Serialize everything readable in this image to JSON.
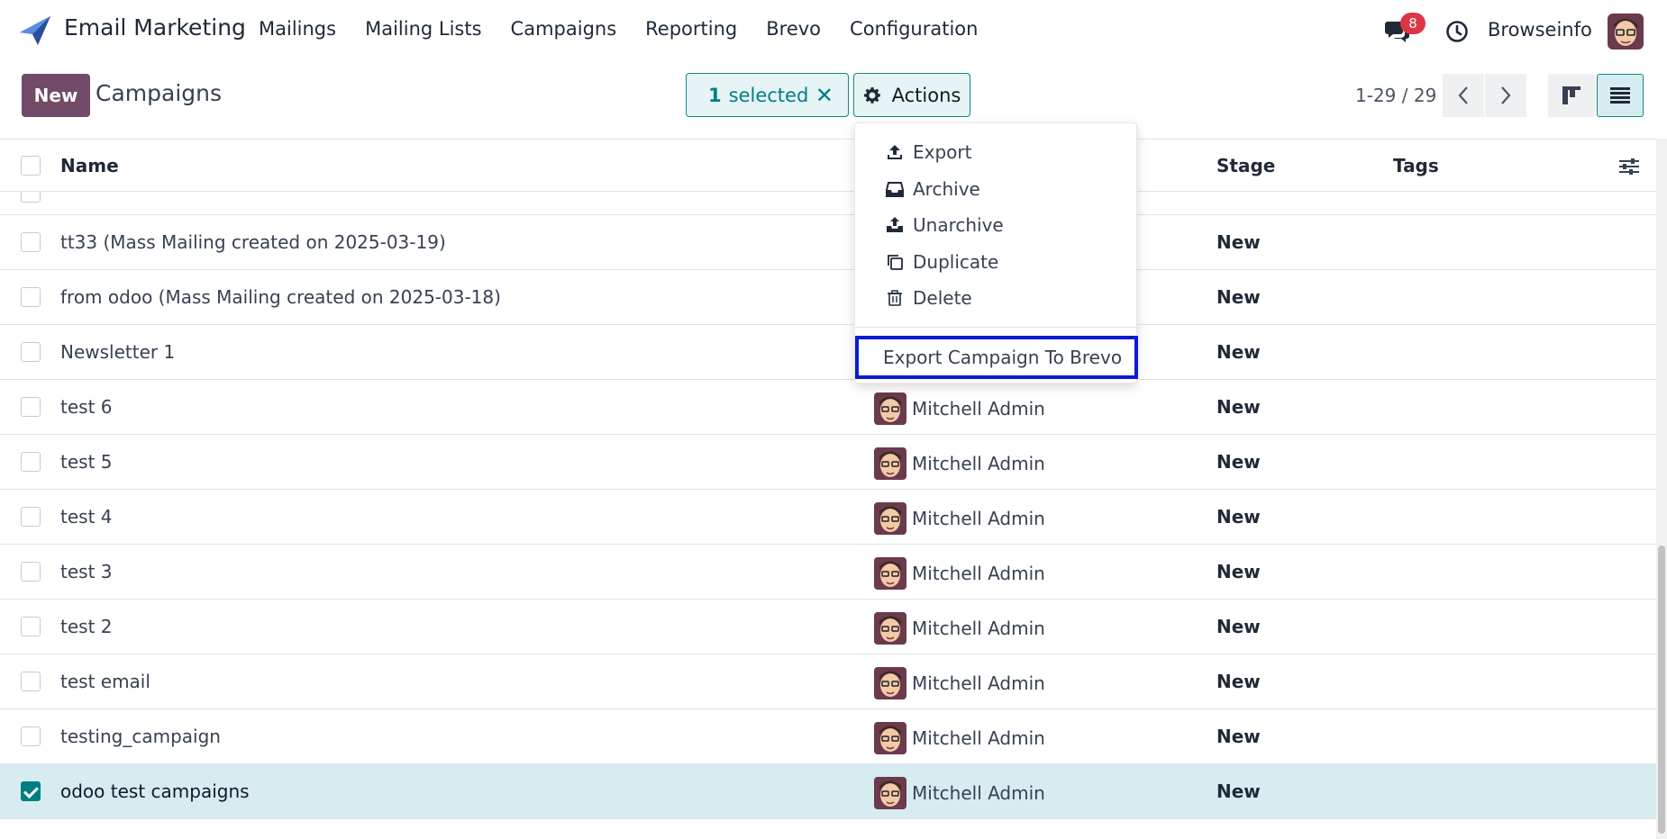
{
  "navbar": {
    "app_name": "Email Marketing",
    "menu": [
      "Mailings",
      "Mailing Lists",
      "Campaigns",
      "Reporting",
      "Brevo",
      "Configuration"
    ],
    "messages_badge": "8",
    "company": "Browseinfo"
  },
  "control_panel": {
    "new_label": "New",
    "title": "Campaigns",
    "selected_count": "1",
    "selected_label": "selected",
    "clear_icon": "✕",
    "actions_label": "Actions",
    "pager_text": "1-29 / 29"
  },
  "table": {
    "headers": {
      "name": "Name",
      "stage": "Stage",
      "tags": "Tags"
    },
    "rows": [
      {
        "name": "tt33 (Mass Mailing created on 2025-03-19)",
        "responsible": "",
        "stage": "New",
        "selected": false
      },
      {
        "name": "from odoo (Mass Mailing created on 2025-03-18)",
        "responsible": "",
        "stage": "New",
        "selected": false
      },
      {
        "name": "Newsletter 1",
        "responsible": "",
        "stage": "New",
        "selected": false
      },
      {
        "name": "test 6",
        "responsible": "Mitchell Admin",
        "stage": "New",
        "selected": false
      },
      {
        "name": "test 5",
        "responsible": "Mitchell Admin",
        "stage": "New",
        "selected": false
      },
      {
        "name": "test 4",
        "responsible": "Mitchell Admin",
        "stage": "New",
        "selected": false
      },
      {
        "name": "test 3",
        "responsible": "Mitchell Admin",
        "stage": "New",
        "selected": false
      },
      {
        "name": "test 2",
        "responsible": "Mitchell Admin",
        "stage": "New",
        "selected": false
      },
      {
        "name": "test email",
        "responsible": "Mitchell Admin",
        "stage": "New",
        "selected": false
      },
      {
        "name": "testing_campaign",
        "responsible": "Mitchell Admin",
        "stage": "New",
        "selected": false
      },
      {
        "name": "odoo test campaigns",
        "responsible": "Mitchell Admin",
        "stage": "New",
        "selected": true
      }
    ]
  },
  "actions_menu": {
    "items": [
      {
        "label": "Export",
        "icon": "upload-icon"
      },
      {
        "label": "Archive",
        "icon": "archive-icon"
      },
      {
        "label": "Unarchive",
        "icon": "unarchive-icon"
      },
      {
        "label": "Duplicate",
        "icon": "copy-icon"
      },
      {
        "label": "Delete",
        "icon": "trash-icon"
      }
    ],
    "custom_action": "Export Campaign To Brevo"
  },
  "colors": {
    "brand": "#714b67",
    "accent": "#017e84",
    "selected_row": "#d7ecf0",
    "highlight_border": "#0b1bd6",
    "badge": "#dc3545"
  }
}
